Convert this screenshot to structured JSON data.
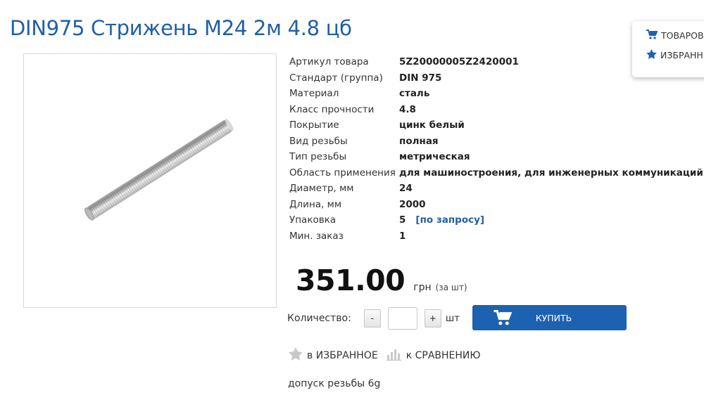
{
  "product": {
    "title": "DIN975 Стрижень М24 2м 4.8 цб"
  },
  "side_panel": {
    "cart_label": "ТОВАРОВ",
    "favorites_label": "ИЗБРАНН"
  },
  "specs": [
    {
      "label": "Артикул товара",
      "value": "5Z20000005Z2420001"
    },
    {
      "label": "Стандарт (группа)",
      "value": "DIN 975"
    },
    {
      "label": "Материал",
      "value": "сталь"
    },
    {
      "label": "Класс прочности",
      "value": "4.8"
    },
    {
      "label": "Покрытие",
      "value": "цинк белый"
    },
    {
      "label": "Вид резьбы",
      "value": "полная"
    },
    {
      "label": "Тип резьбы",
      "value": "метрическая"
    },
    {
      "label": "Область применения",
      "value": "для машиностроения, для инженерных коммуникаций"
    },
    {
      "label": "Диаметр, мм",
      "value": "24"
    },
    {
      "label": "Длина, мм",
      "value": "2000"
    },
    {
      "label": "Упаковка",
      "value": "5",
      "extra": "[по запросу]"
    },
    {
      "label": "Мин. заказ",
      "value": "1"
    }
  ],
  "price": {
    "amount": "351.00",
    "currency": "грн",
    "per_unit": "(за шт)"
  },
  "quantity": {
    "label": "Количество:",
    "minus": "-",
    "plus": "+",
    "value": "",
    "unit": "шт"
  },
  "buy_button": {
    "label": "КУПИТЬ"
  },
  "actions": {
    "favorite_label": "в ИЗБРАННОЕ",
    "compare_label": "к СРАВНЕНИЮ"
  },
  "note": "допуск резьбы 6g",
  "icons": {
    "cart": "cart-icon",
    "star": "star-icon",
    "compare": "bar-chart-icon"
  },
  "colors": {
    "accent": "#1d62b0",
    "title": "#1f5fa8",
    "link": "#1f5fa8"
  }
}
